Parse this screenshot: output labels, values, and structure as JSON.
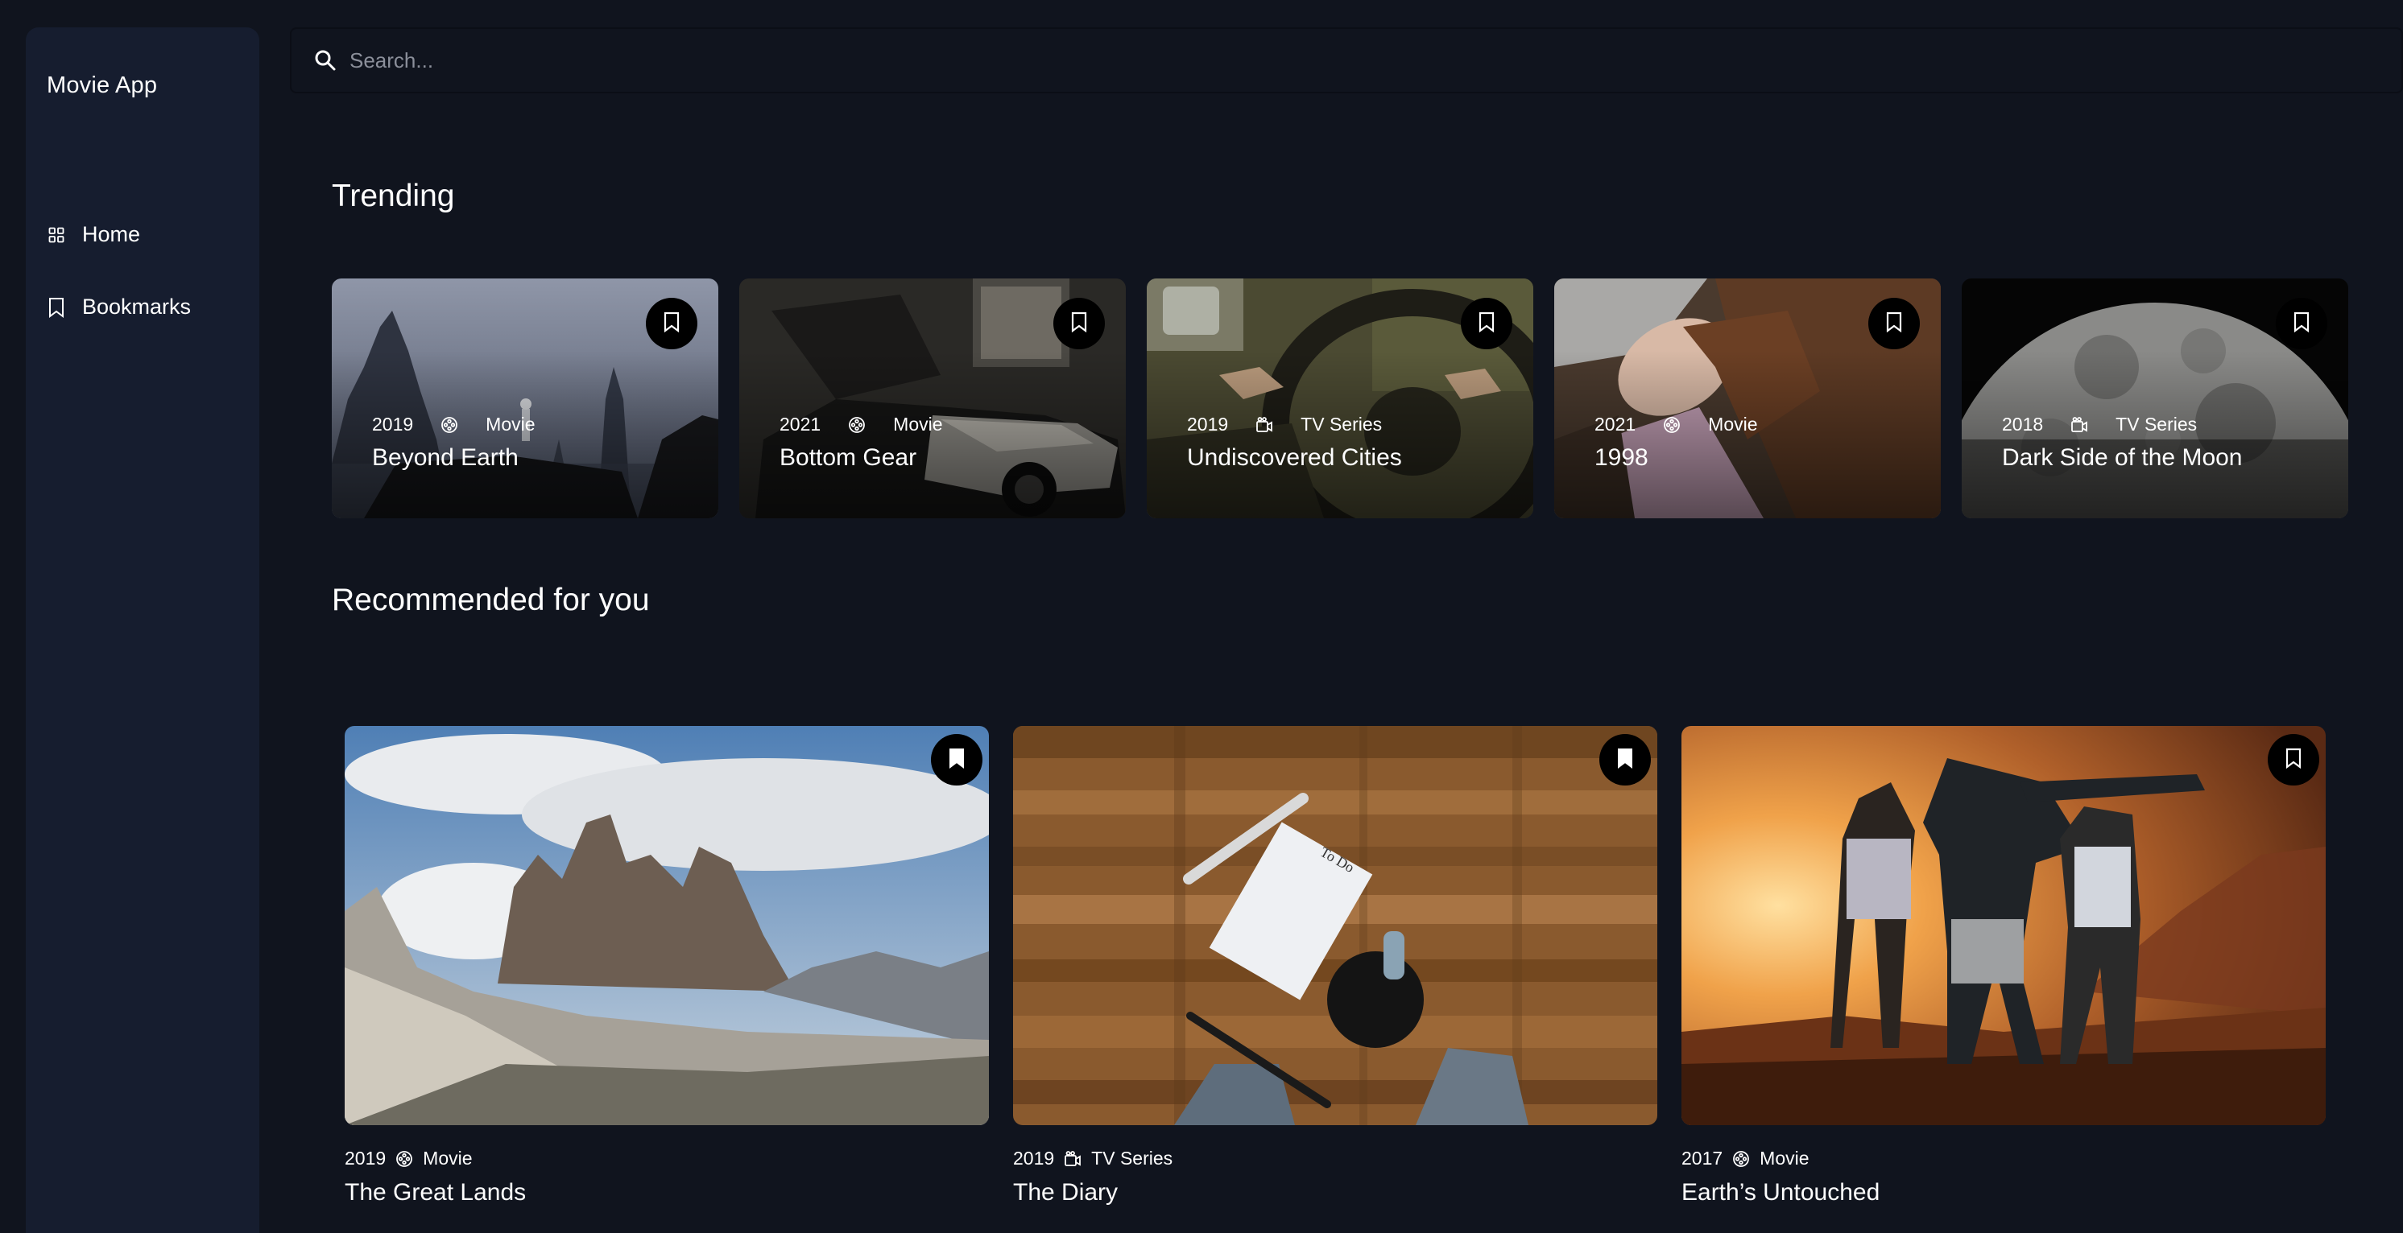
{
  "app": {
    "name": "Movie App"
  },
  "nav": {
    "items": [
      {
        "label": "Home",
        "icon": "grid-icon"
      },
      {
        "label": "Bookmarks",
        "icon": "bookmark-icon"
      }
    ]
  },
  "search": {
    "placeholder": "Search...",
    "value": ""
  },
  "sections": {
    "trending": "Trending",
    "recommended": "Recommended for you"
  },
  "trending": [
    {
      "year": "2019",
      "category": "Movie",
      "category_icon": "film-reel-icon",
      "title": "Beyond Earth",
      "bookmarked": false
    },
    {
      "year": "2021",
      "category": "Movie",
      "category_icon": "film-reel-icon",
      "title": "Bottom Gear",
      "bookmarked": false
    },
    {
      "year": "2019",
      "category": "TV Series",
      "category_icon": "tv-camera-icon",
      "title": "Undiscovered Cities",
      "bookmarked": false
    },
    {
      "year": "2021",
      "category": "Movie",
      "category_icon": "film-reel-icon",
      "title": "1998",
      "bookmarked": false
    },
    {
      "year": "2018",
      "category": "TV Series",
      "category_icon": "tv-camera-icon",
      "title": "Dark Side of the Moon",
      "bookmarked": false
    }
  ],
  "recommended": [
    {
      "year": "2019",
      "category": "Movie",
      "category_icon": "film-reel-icon",
      "title": "The Great Lands",
      "bookmarked": true
    },
    {
      "year": "2019",
      "category": "TV Series",
      "category_icon": "tv-camera-icon",
      "title": "The Diary",
      "bookmarked": true
    },
    {
      "year": "2017",
      "category": "Movie",
      "category_icon": "film-reel-icon",
      "title": "Earth’s Untouched",
      "bookmarked": false
    }
  ],
  "colors": {
    "background": "#10141e",
    "sidebar": "#161d2f",
    "text": "#ffffff",
    "placeholder": "#8b8f9a",
    "bookmark_button": "#000000"
  }
}
